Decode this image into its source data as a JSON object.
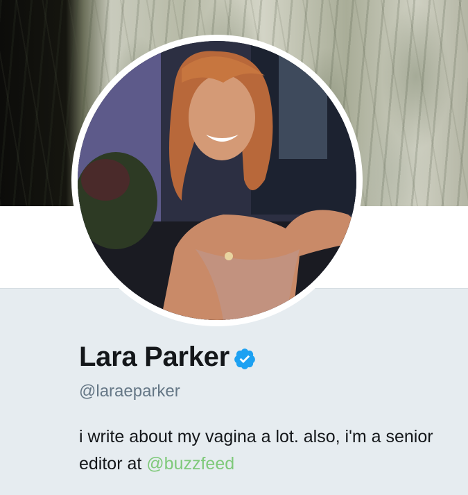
{
  "profile": {
    "name": "Lara Parker",
    "handle": "@laraeparker",
    "verified": true,
    "bio_text": "i write about my vagina a lot. also, i'm a senior editor at ",
    "bio_mention": "@buzzfeed"
  },
  "icons": {
    "verified": "verified-badge-icon"
  },
  "colors": {
    "page_background": "#e6ecf0",
    "name_text": "#14171a",
    "handle_text": "#657786",
    "link": "#7fc97a",
    "verified_badge": "#1da1f2"
  }
}
